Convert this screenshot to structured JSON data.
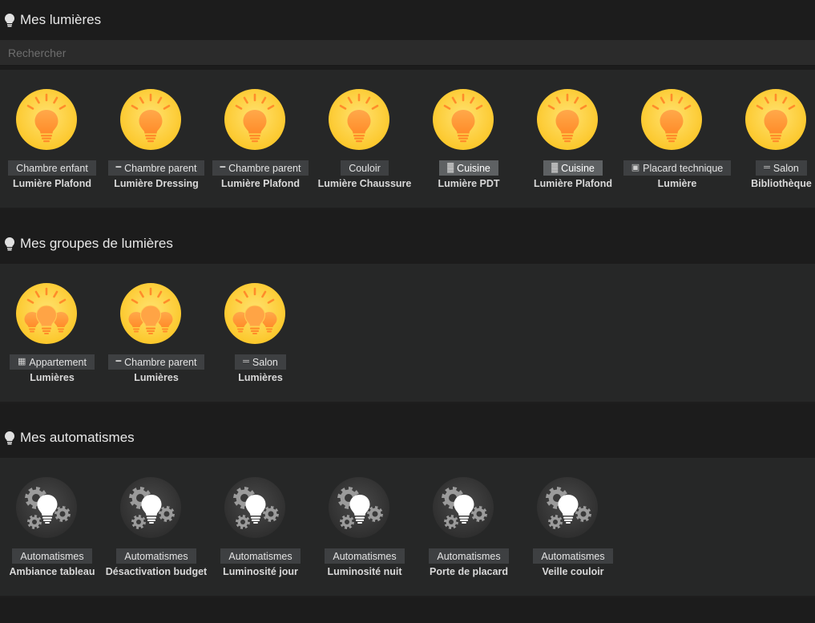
{
  "sections": {
    "lights_title": "Mes lumières",
    "groups_title": "Mes groupes de lumières",
    "auto_title": "Mes automatismes"
  },
  "search": {
    "placeholder": "Rechercher"
  },
  "lights": [
    {
      "room": "Chambre enfant",
      "room_icon": "",
      "name": "Lumière Plafond"
    },
    {
      "room": "Chambre parent",
      "room_icon": "bed-icon",
      "name": "Lumière Dressing"
    },
    {
      "room": "Chambre parent",
      "room_icon": "bed-icon",
      "name": "Lumière Plafond"
    },
    {
      "room": "Couloir",
      "room_icon": "",
      "name": "Lumière Chaussure"
    },
    {
      "room": "Cuisine",
      "room_icon": "kitchen-icon",
      "name": "Lumière PDT",
      "active": true
    },
    {
      "room": "Cuisine",
      "room_icon": "kitchen-icon",
      "name": "Lumière Plafond",
      "active": true
    },
    {
      "room": "Placard technique",
      "room_icon": "cabinet-icon",
      "name": "Lumière"
    },
    {
      "room": "Salon",
      "room_icon": "sofa-icon",
      "name": "Bibliothèque"
    }
  ],
  "groups": [
    {
      "room": "Appartement",
      "room_icon": "house-icon",
      "name": "Lumières"
    },
    {
      "room": "Chambre parent",
      "room_icon": "bed-icon",
      "name": "Lumières"
    },
    {
      "room": "Salon",
      "room_icon": "sofa-icon",
      "name": "Lumières"
    }
  ],
  "automations": [
    {
      "room": "Automatismes",
      "name": "Ambiance tableau"
    },
    {
      "room": "Automatismes",
      "name": "Désactivation budget"
    },
    {
      "room": "Automatismes",
      "name": "Luminosité jour"
    },
    {
      "room": "Automatismes",
      "name": "Luminosité nuit"
    },
    {
      "room": "Automatismes",
      "name": "Porte de placard"
    },
    {
      "room": "Automatismes",
      "name": "Veille couloir"
    }
  ],
  "colors": {
    "background": "#1c1c1c",
    "panel": "#262727",
    "badge": "#3e4042",
    "badge_active": "#5e6163",
    "bulb_circle": "#ffd54a",
    "bulb": "#ff9a3c"
  }
}
